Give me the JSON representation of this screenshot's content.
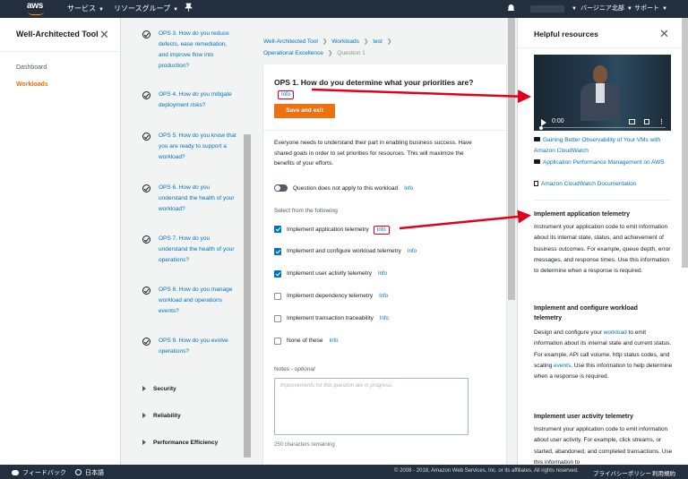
{
  "topnav": {
    "logo": "aws",
    "services": "サービス",
    "resource_groups": "リソースグループ",
    "region": "バージニア北部",
    "support": "サポート"
  },
  "sidebar": {
    "title": "Well-Architected Tool",
    "items": [
      {
        "label": "Dashboard"
      },
      {
        "label": "Workloads"
      }
    ]
  },
  "questions": [
    {
      "label": "OPS 3. How do you reduce defects, ease remediation, and improve flow into production?"
    },
    {
      "label": "OPS 4. How do you mitigate deployment risks?"
    },
    {
      "label": "OPS 5. How do you know that you are ready to support a workload?"
    },
    {
      "label": "OPS 6. How do you understand the health of your workload?"
    },
    {
      "label": "OPS 7. How do you understand the health of your operations?"
    },
    {
      "label": "OPS 8. How do you manage workload and operations events?"
    },
    {
      "label": "OPS 9. How do you evolve operations?"
    }
  ],
  "pillars": [
    {
      "label": "Security"
    },
    {
      "label": "Reliability"
    },
    {
      "label": "Performance Efficiency"
    }
  ],
  "breadcrumb": {
    "tool": "Well-Architected Tool",
    "workloads": "Workloads",
    "workload": "test",
    "pillar": "Operational Excellence",
    "current": "Question 1"
  },
  "question": {
    "title": "OPS 1. How do you determine what your priorities are?",
    "info": "Info",
    "save_label": "Save and exit",
    "description": "Everyone needs to understand their part in enabling business success. Have shared goals in order to set priorities for resources. This will maximize the benefits of your efforts.",
    "not_apply": "Question does not apply to this workload",
    "select_label": "Select from the following",
    "choices": [
      {
        "label": "Implement application telemetry",
        "checked": true
      },
      {
        "label": "Implement and configure workload telemetry",
        "checked": true
      },
      {
        "label": "Implement user activity telemetry",
        "checked": true
      },
      {
        "label": "Implement dependency telemetry",
        "checked": false
      },
      {
        "label": "Implement transaction traceability",
        "checked": false
      },
      {
        "label": "None of these",
        "checked": false
      }
    ],
    "notes_label": "Notes - ",
    "notes_optional": "optional",
    "notes_placeholder": "Improvements for this question are in progress.",
    "chars_remaining": "250 characters remaining"
  },
  "help": {
    "title": "Helpful resources",
    "video_time": "0:00",
    "links": [
      {
        "label": "Gaining Better Observability of Your VMs with Amazon CloudWatch",
        "icon": "youtube-icon"
      },
      {
        "label": "Application Performance Management on AWS",
        "icon": "youtube-icon"
      },
      {
        "label": "Amazon CloudWatch Documentation",
        "icon": "document-icon"
      }
    ],
    "sections": [
      {
        "title": "Implement application telemetry",
        "body": "Instrument your application code to emit information about its internal state, status, and achievement of business outcomes. For example, queue depth, error messages, and response times. Use this information to determine when a response is required."
      },
      {
        "title": "Implement and configure workload telemetry",
        "body_1": "Design and configure your ",
        "link_1": "workload",
        "body_2": " to emit information about its internal state and current status. For example, API call volume, http status codes, and scaling ",
        "link_2": "events",
        "body_3": ". Use this information to help determine when a response is required."
      },
      {
        "title": "Implement user activity telemetry",
        "body": "Instrument your application code to emit information about user activity. For example, click streams, or started, abandoned, and completed transactions. Use this information to"
      }
    ]
  },
  "footer": {
    "feedback": "フィードバック",
    "language": "日本語",
    "copyright": "© 2008 - 2018, Amazon Web Services, Inc. or its affiliates. All rights reserved.",
    "privacy": "プライバシーポリシー",
    "terms": "利用規約"
  },
  "colors": {
    "nav_bg": "#232f3e",
    "accent": "#ec7211",
    "link": "#0073bb",
    "annotation": "#e1001b"
  }
}
